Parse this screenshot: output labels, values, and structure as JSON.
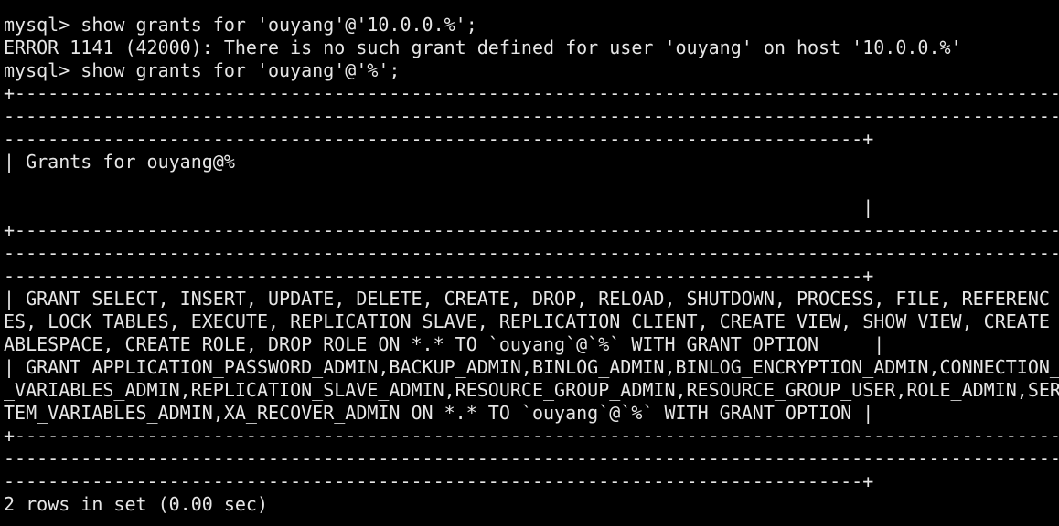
{
  "terminal": {
    "background": "#000000",
    "foreground": "#e6e6e6",
    "lines": [
      "mysql> show grants for 'ouyang'@'10.0.0.%';",
      "ERROR 1141 (42000): There is no such grant defined for user 'ouyang' on host '10.0.0.%'",
      "mysql> show grants for 'ouyang'@'%';",
      "+------------------------------------------------------------------------------------------------",
      "------------------------------------------------------------------------------------------------",
      "------------------------------------------------------------------------------+",
      "| Grants for ouyang@%",
      "",
      "                                                                              |",
      "+------------------------------------------------------------------------------------------------",
      "------------------------------------------------------------------------------------------------",
      "------------------------------------------------------------------------------+",
      "| GRANT SELECT, INSERT, UPDATE, DELETE, CREATE, DROP, RELOAD, SHUTDOWN, PROCESS, FILE, REFERENC",
      "ES, LOCK TABLES, EXECUTE, REPLICATION SLAVE, REPLICATION CLIENT, CREATE VIEW, SHOW VIEW, CREATE",
      "ABLESPACE, CREATE ROLE, DROP ROLE ON *.* TO `ouyang`@`%` WITH GRANT OPTION     |",
      "| GRANT APPLICATION_PASSWORD_ADMIN,BACKUP_ADMIN,BINLOG_ADMIN,BINLOG_ENCRYPTION_ADMIN,CONNECTION_",
      "_VARIABLES_ADMIN,REPLICATION_SLAVE_ADMIN,RESOURCE_GROUP_ADMIN,RESOURCE_GROUP_USER,ROLE_ADMIN,SER",
      "TEM_VARIABLES_ADMIN,XA_RECOVER_ADMIN ON *.* TO `ouyang`@`%` WITH GRANT OPTION |",
      "+------------------------------------------------------------------------------------------------",
      "------------------------------------------------------------------------------------------------",
      "------------------------------------------------------------------------------+",
      "2 rows in set (0.00 sec)"
    ]
  }
}
